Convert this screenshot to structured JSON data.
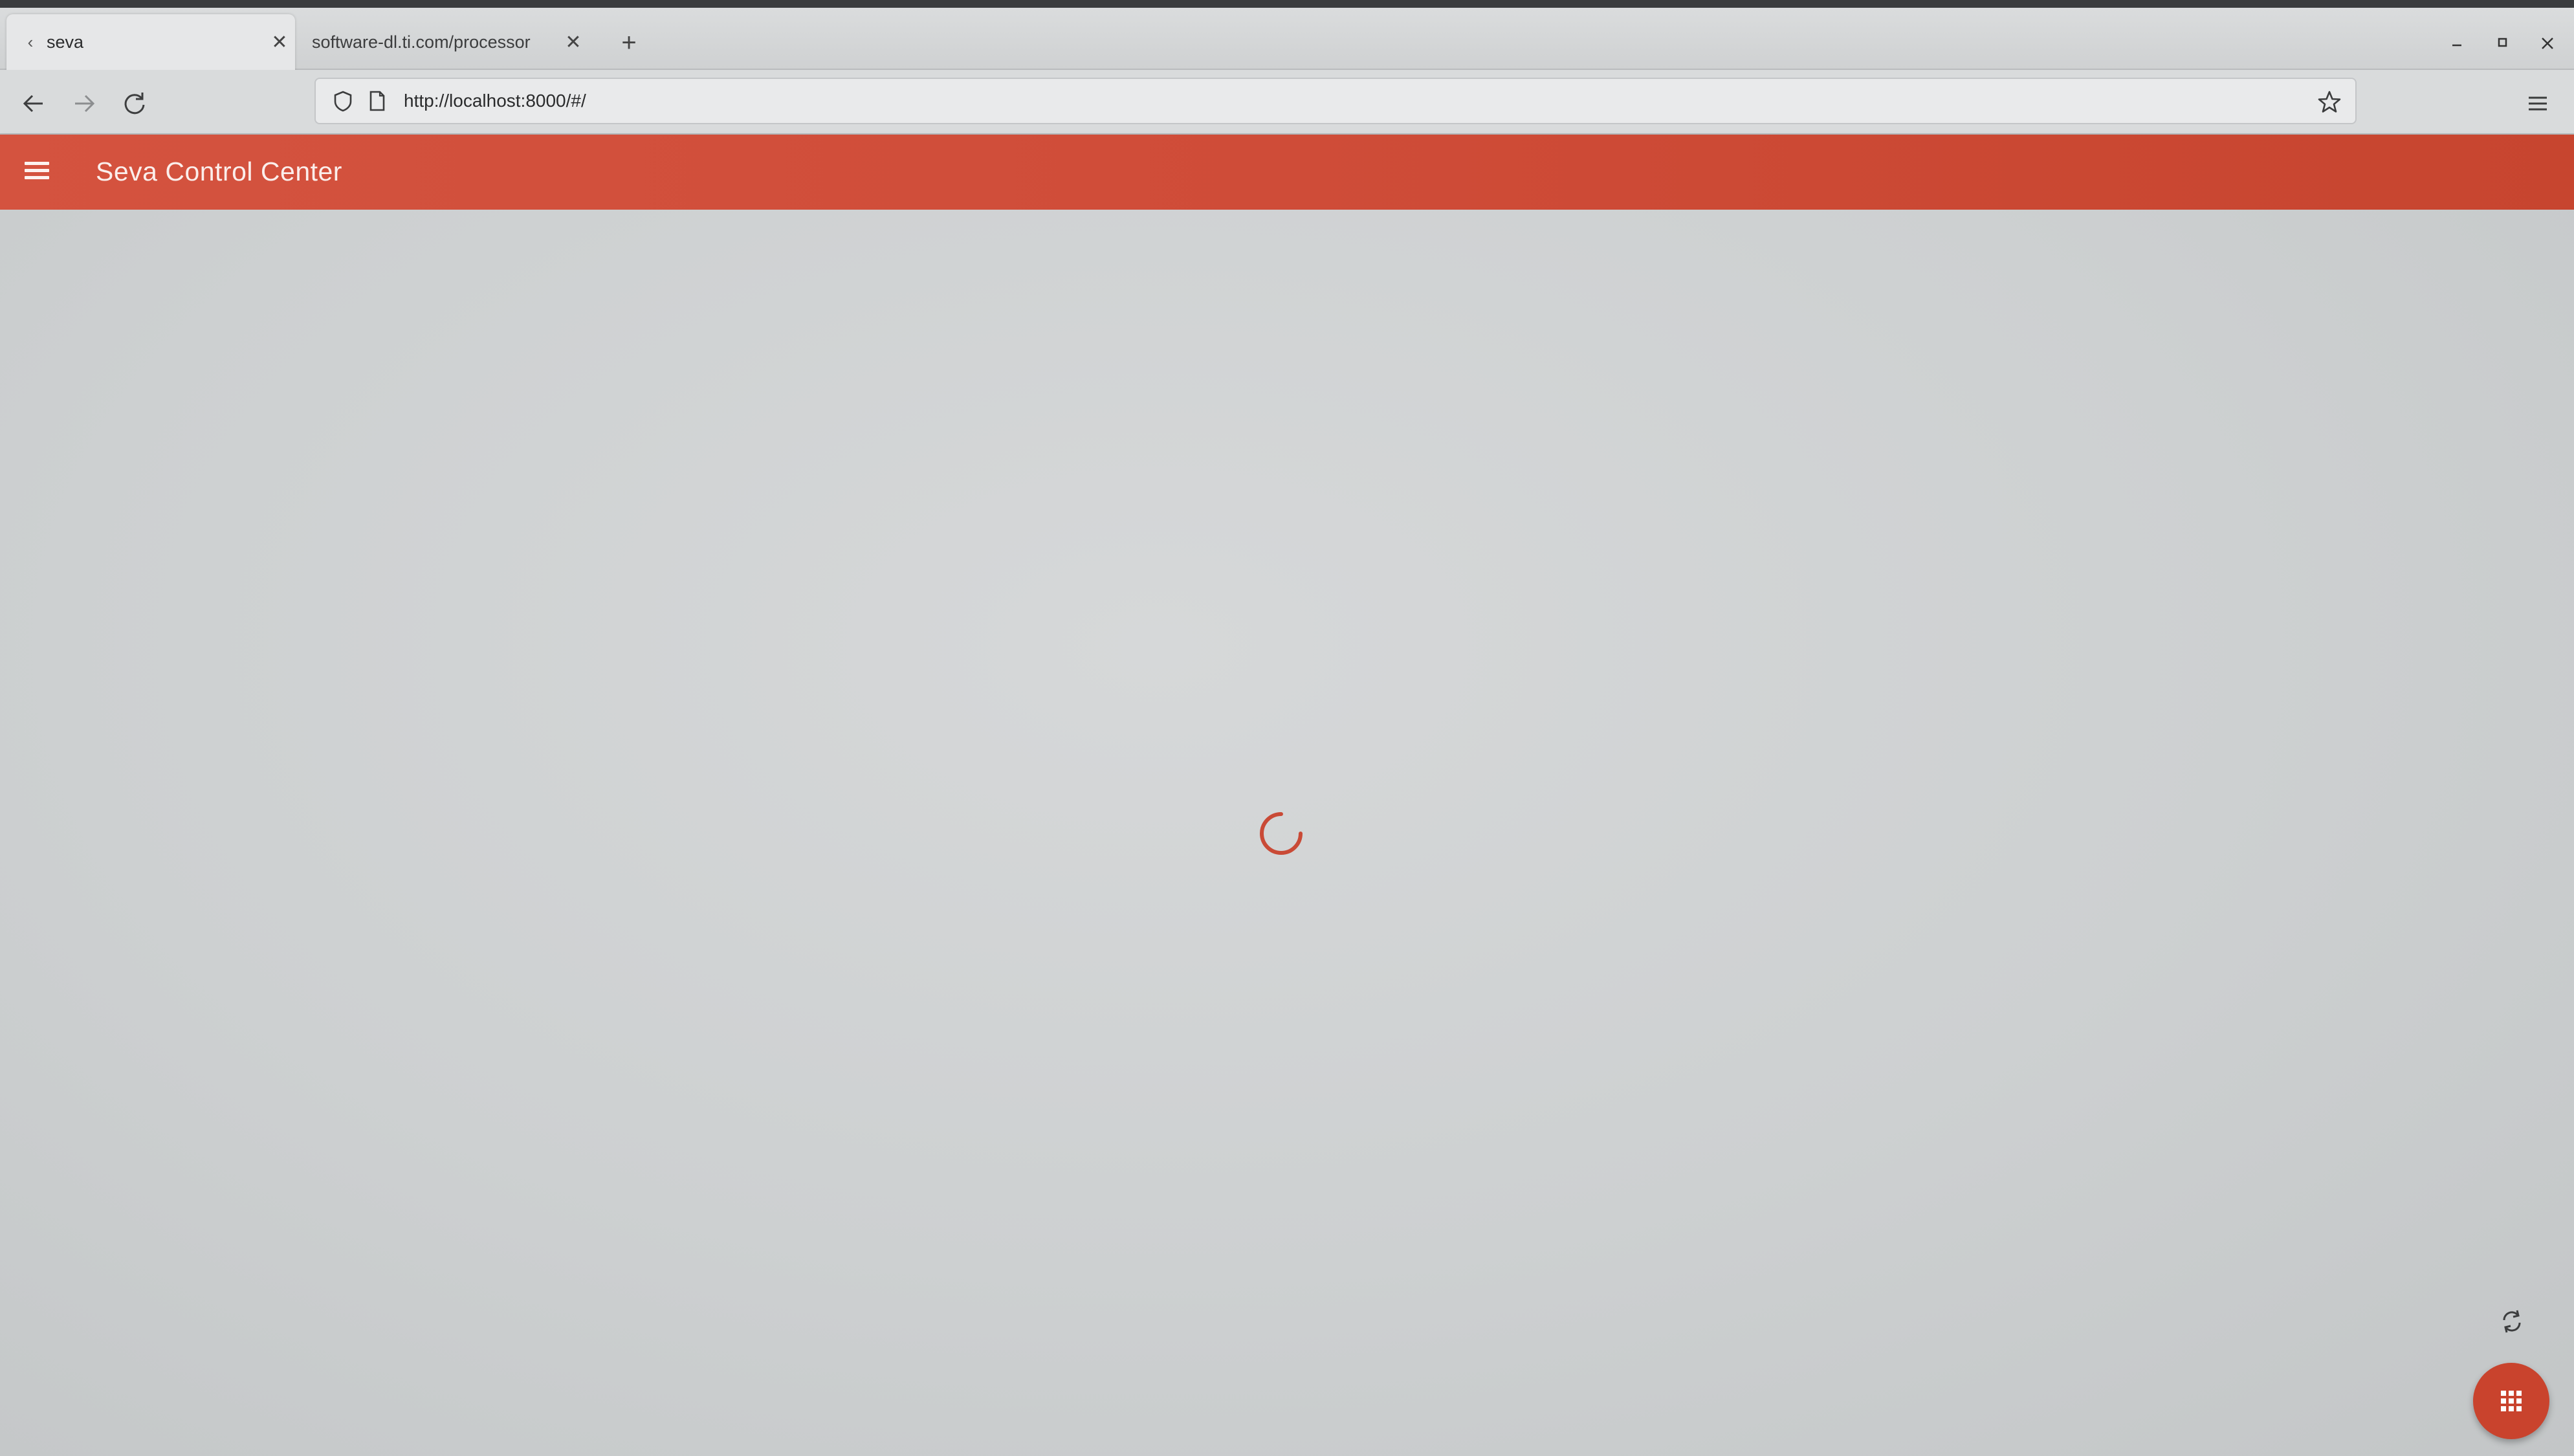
{
  "browser": {
    "tabs": [
      {
        "title": "seva",
        "active": true
      },
      {
        "title": "software-dl.ti.com/processor",
        "active": false
      }
    ],
    "new_tab_label": "+",
    "tab_close_label": "✕",
    "url": "http://localhost:8000/#/"
  },
  "app": {
    "title": "Seva Control Center",
    "loading": true
  },
  "colors": {
    "accent": "#cf4c38",
    "fab": "#c9432d",
    "spinner": "#c94a36"
  },
  "icons": {
    "back": "arrow-left-icon",
    "forward": "arrow-right-icon",
    "reload": "reload-icon",
    "shield": "shield-icon",
    "page": "page-icon",
    "bookmark": "star-icon",
    "menu": "hamburger-menu-icon",
    "sync": "sync-icon",
    "apps": "grid-icon"
  }
}
